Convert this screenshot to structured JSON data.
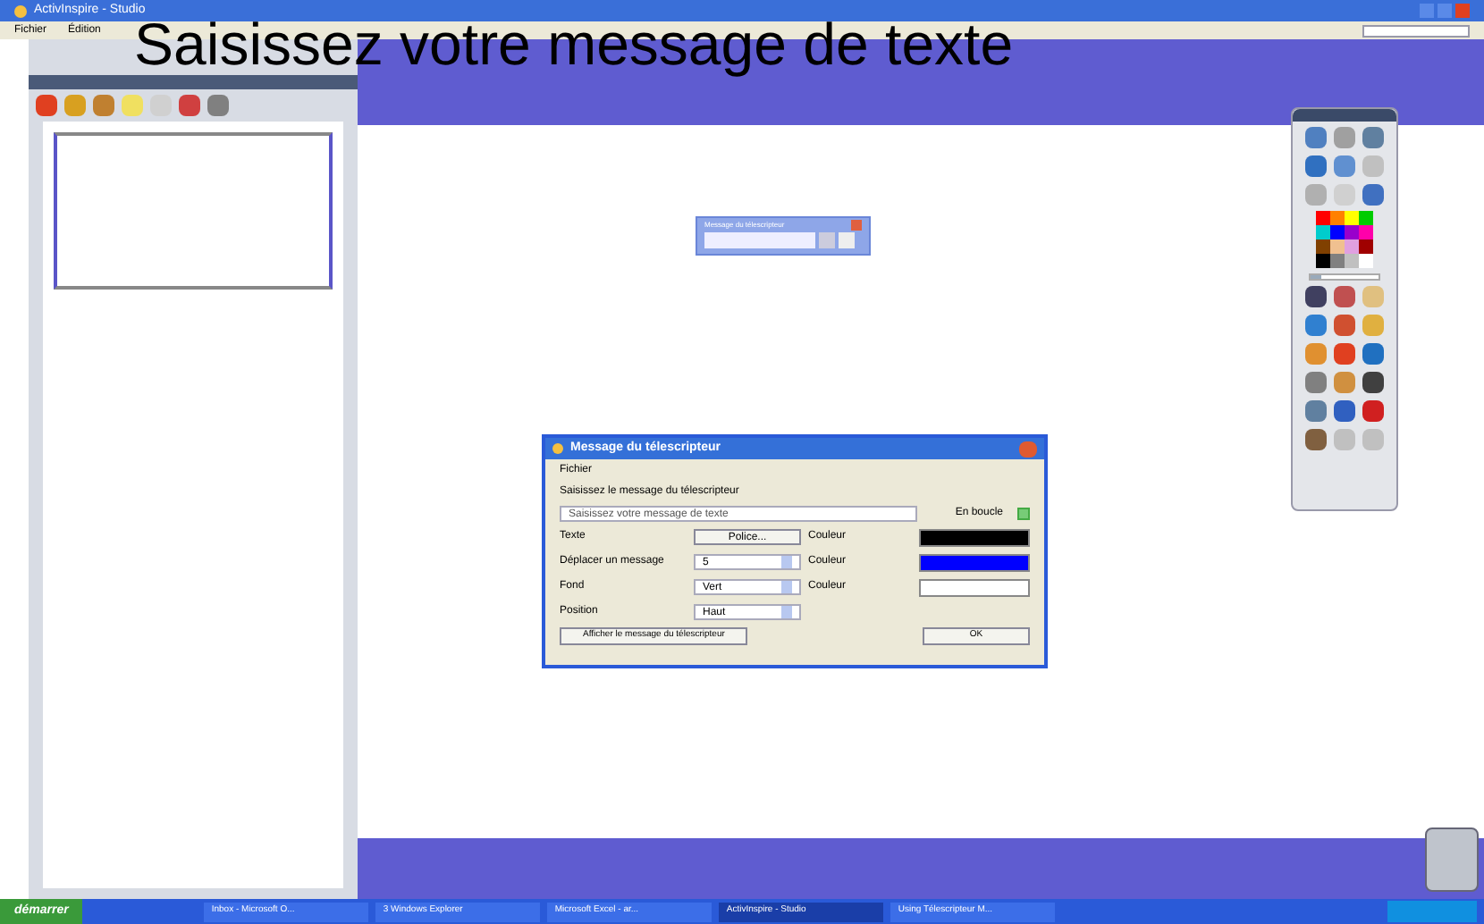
{
  "window": {
    "title": "ActivInspire - Studio"
  },
  "menu": [
    "Fichier",
    "Édition"
  ],
  "ticker_text": "Saisissez votre message de texte",
  "ticker_widget": {
    "title": "Message du télescripteur"
  },
  "dialog": {
    "title": "Message du télescripteur",
    "menu": "Fichier",
    "prompt": "Saisissez le message du télescripteur",
    "message": "Saisissez votre message de texte",
    "loop_label": "En boucle",
    "loop": true,
    "rows": [
      {
        "kind": "button",
        "label": "Texte",
        "value": "Police...",
        "color_label": "Couleur",
        "color": "#000000"
      },
      {
        "kind": "spin",
        "label": "Déplacer un message",
        "value": "5",
        "color_label": "Couleur",
        "color": "#0000ff"
      },
      {
        "kind": "select",
        "label": "Fond",
        "value": "Vert",
        "color_label": "Couleur",
        "color": "#ffffff"
      },
      {
        "kind": "select",
        "label": "Position",
        "value": "Haut"
      }
    ],
    "show_button": "Afficher le message du télescripteur",
    "ok_button": "OK"
  },
  "toolbox": {
    "width_slider": {
      "level": 0.15
    },
    "palette": [
      {
        "color": "#ff0000"
      },
      {
        "color": "#ff8000"
      },
      {
        "color": "#ffff00"
      },
      {
        "color": "#00cc00"
      },
      {
        "color": "#00cccc"
      },
      {
        "color": "#0000ff"
      },
      {
        "color": "#9900cc"
      },
      {
        "color": "#ff00aa"
      },
      {
        "color": "#804000"
      },
      {
        "color": "#f0c090"
      },
      {
        "color": "#e0a0e0"
      },
      {
        "color": "#a00000"
      },
      {
        "color": "#000000"
      },
      {
        "color": "#808080"
      },
      {
        "color": "#c0c0c0"
      },
      {
        "color": "#ffffff"
      }
    ]
  },
  "taskbar": {
    "start": "démarrer",
    "items": [
      {
        "label": "Inbox - Microsoft O...",
        "selected": false
      },
      {
        "label": "3 Windows Explorer",
        "selected": false
      },
      {
        "label": "Microsoft Excel - ar...",
        "selected": false
      },
      {
        "label": "ActivInspire - Studio",
        "selected": true
      },
      {
        "label": "Using Télescripteur M...",
        "selected": false
      }
    ]
  }
}
